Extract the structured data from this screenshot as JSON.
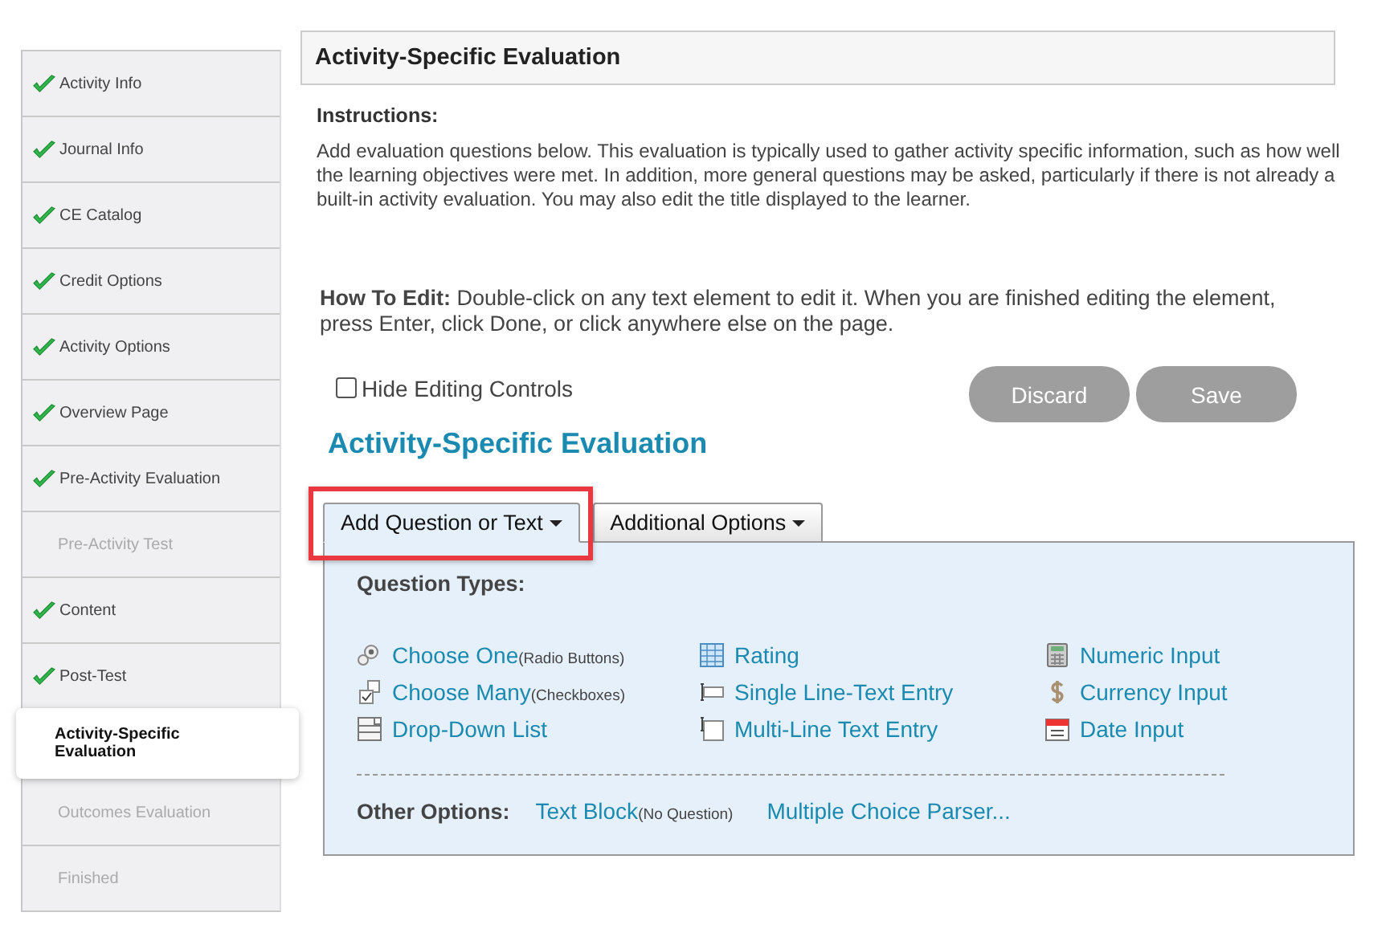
{
  "sidebar": {
    "items": [
      {
        "label": "Activity Info",
        "done": true,
        "disabled": false,
        "selected": false
      },
      {
        "label": "Journal Info",
        "done": true,
        "disabled": false,
        "selected": false
      },
      {
        "label": "CE Catalog",
        "done": true,
        "disabled": false,
        "selected": false
      },
      {
        "label": "Credit Options",
        "done": true,
        "disabled": false,
        "selected": false
      },
      {
        "label": "Activity Options",
        "done": true,
        "disabled": false,
        "selected": false
      },
      {
        "label": "Overview Page",
        "done": true,
        "disabled": false,
        "selected": false
      },
      {
        "label": "Pre-Activity Evaluation",
        "done": true,
        "disabled": false,
        "selected": false
      },
      {
        "label": "Pre-Activity Test",
        "done": false,
        "disabled": true,
        "selected": false
      },
      {
        "label": "Content",
        "done": true,
        "disabled": false,
        "selected": false
      },
      {
        "label": "Post-Test",
        "done": true,
        "disabled": false,
        "selected": false
      },
      {
        "label": "Activity-Specific Evaluation",
        "done": false,
        "disabled": false,
        "selected": true
      },
      {
        "label": "Outcomes Evaluation",
        "done": false,
        "disabled": true,
        "selected": false
      },
      {
        "label": "Finished",
        "done": false,
        "disabled": true,
        "selected": false
      }
    ]
  },
  "header": {
    "title": "Activity-Specific Evaluation"
  },
  "instructions": {
    "heading": "Instructions:",
    "text": "Add evaluation questions below. This evaluation is typically used to gather activity specific information, such as how well the learning objectives were met. In addition, more general questions may be asked, particularly if there is not already a built-in activity evaluation. You may also edit the title displayed to the learner."
  },
  "how_to_edit": "**How To Edit:** Double-click on any text element to edit it. When you are finished editing the element, press Enter, click Done, or click anywhere else on the page.",
  "hide_controls": {
    "label": "Hide Editing Controls",
    "checked": false
  },
  "buttons": [
    {
      "label": "Discard",
      "disabled": true
    },
    {
      "label": "Save",
      "disabled": true
    }
  ],
  "evaluation_title": "Activity-Specific Evaluation",
  "tabs": [
    {
      "label": "Add Question or Text",
      "selected": true,
      "highlighted": true
    },
    {
      "label": "Additional Options",
      "selected": false,
      "highlighted": false
    }
  ],
  "question_types": {
    "heading": "Question Types:",
    "items": [
      {
        "kind": "radio",
        "label": "Choose One",
        "note": "(Radio Buttons)"
      },
      {
        "kind": "rating",
        "label": "Rating"
      },
      {
        "kind": "numeric",
        "label": "Numeric Input"
      },
      {
        "kind": "checkbox",
        "label": "Choose Many",
        "note": "(Checkboxes)"
      },
      {
        "kind": "single",
        "label": "Single Line-Text Entry"
      },
      {
        "kind": "currency",
        "label": "Currency Input"
      },
      {
        "kind": "dropdown",
        "label": "Drop-Down List"
      },
      {
        "kind": "multi",
        "label": "Multi-Line Text Entry"
      },
      {
        "kind": "date",
        "label": "Date Input"
      }
    ]
  },
  "other_options": {
    "heading": "Other Options:",
    "items": [
      {
        "label": "Text Block",
        "note": "(No Question)"
      },
      {
        "label": "Multiple Choice Parser..."
      }
    ]
  }
}
